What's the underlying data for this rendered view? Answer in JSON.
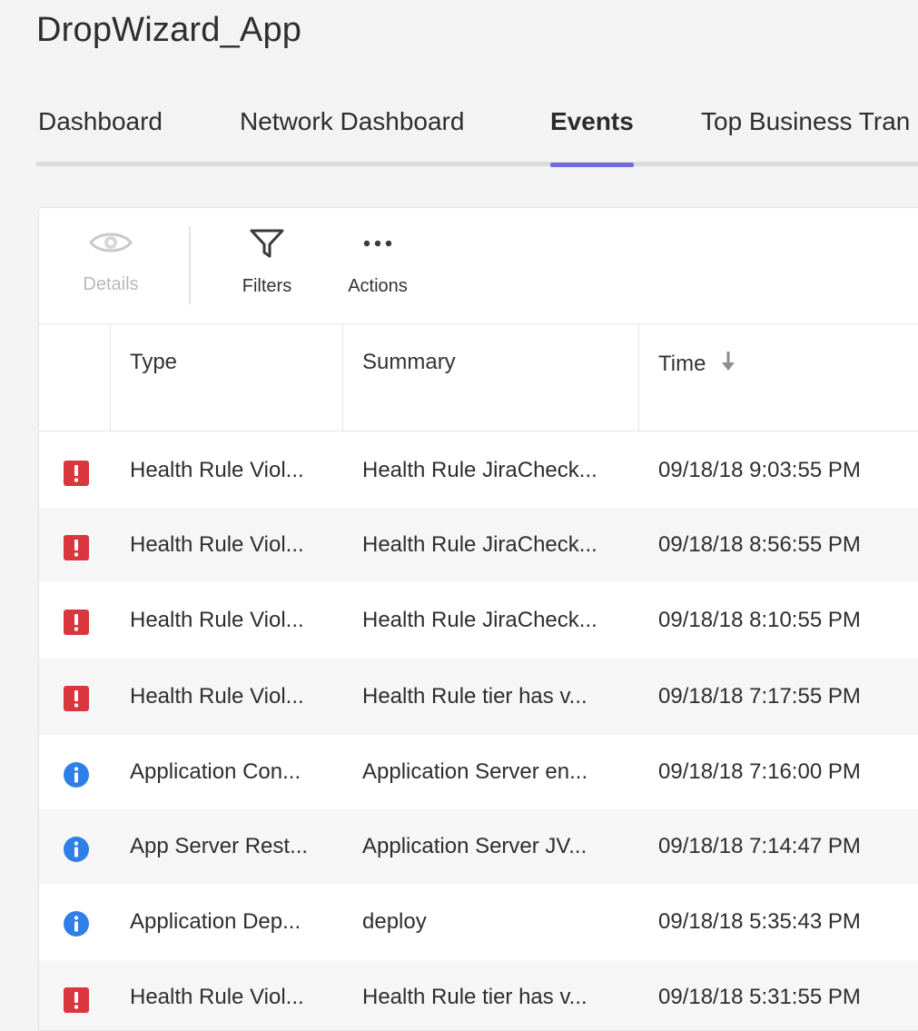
{
  "app": {
    "title": "DropWizard_App"
  },
  "tabs": [
    {
      "label": "Dashboard",
      "active": false
    },
    {
      "label": "Network Dashboard",
      "active": false
    },
    {
      "label": "Events",
      "active": true
    },
    {
      "label": "Top Business Tran",
      "active": false
    }
  ],
  "toolbar": {
    "details_label": "Details",
    "filters_label": "Filters",
    "actions_label": "Actions"
  },
  "table": {
    "columns": [
      "Type",
      "Summary",
      "Time"
    ],
    "sort_column": "Time",
    "sort_direction": "descending",
    "rows": [
      {
        "severity": "error",
        "type": "Health Rule Viol...",
        "summary": "Health Rule JiraCheck...",
        "time": "09/18/18 9:03:55 PM"
      },
      {
        "severity": "error",
        "type": "Health Rule Viol...",
        "summary": "Health Rule JiraCheck...",
        "time": "09/18/18 8:56:55 PM"
      },
      {
        "severity": "error",
        "type": "Health Rule Viol...",
        "summary": "Health Rule JiraCheck...",
        "time": "09/18/18 8:10:55 PM"
      },
      {
        "severity": "error",
        "type": "Health Rule Viol...",
        "summary": "Health Rule tier has v...",
        "time": "09/18/18 7:17:55 PM"
      },
      {
        "severity": "info",
        "type": "Application Con...",
        "summary": "Application Server en...",
        "time": "09/18/18 7:16:00 PM"
      },
      {
        "severity": "info",
        "type": "App Server Rest...",
        "summary": "Application Server JV...",
        "time": "09/18/18 7:14:47 PM"
      },
      {
        "severity": "info",
        "type": "Application Dep...",
        "summary": "deploy",
        "time": "09/18/18 5:35:43 PM"
      },
      {
        "severity": "error",
        "type": "Health Rule Viol...",
        "summary": "Health Rule tier has v...",
        "time": "09/18/18 5:31:55 PM"
      }
    ]
  },
  "colors": {
    "accent": "#6e6be0",
    "error": "#d9363e",
    "info": "#2f7fe8"
  }
}
